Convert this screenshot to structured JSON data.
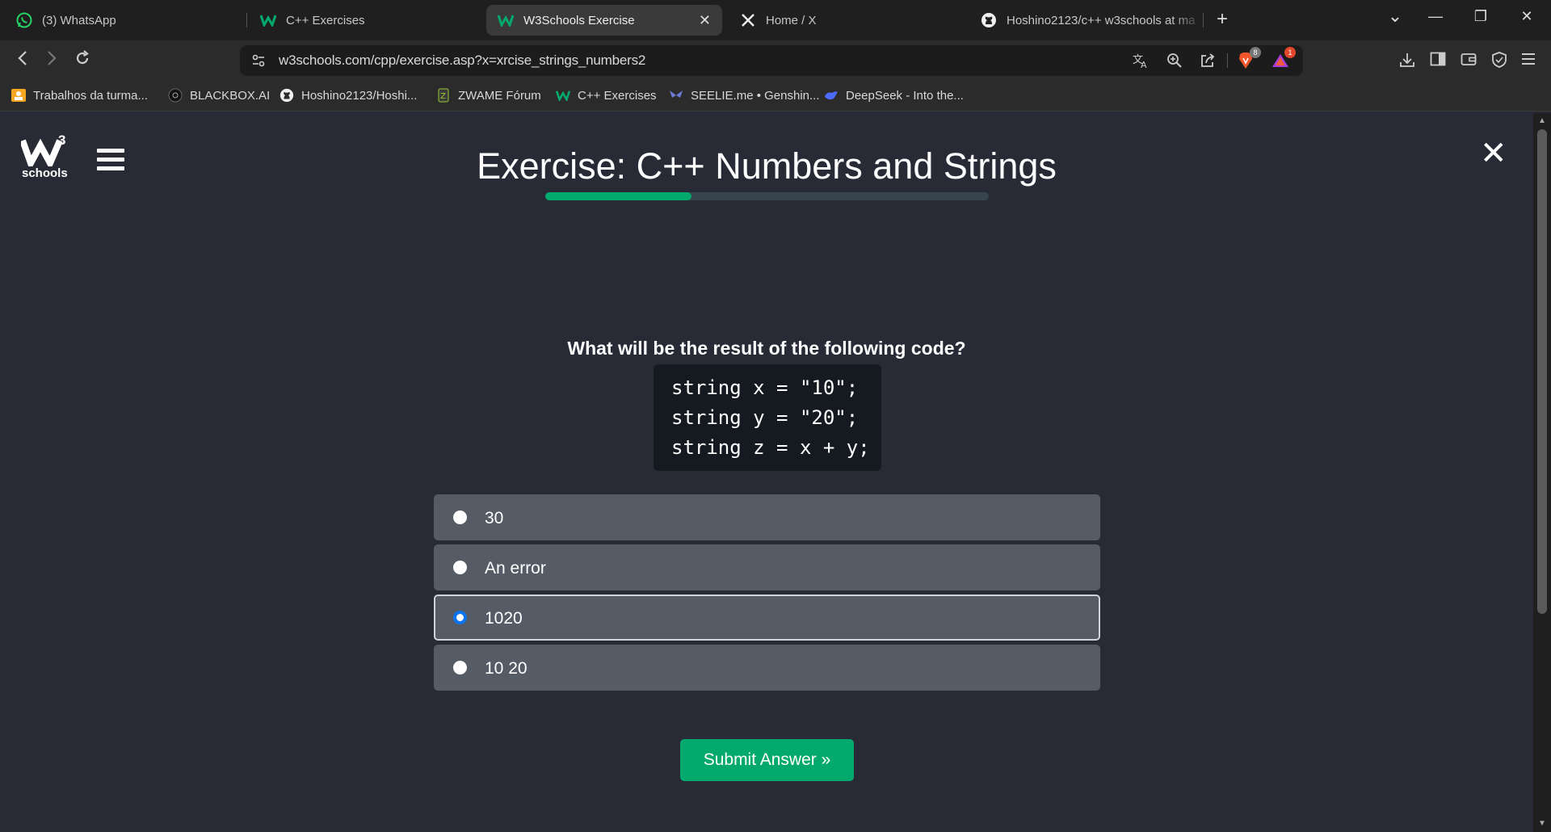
{
  "tabs": [
    {
      "title": "(3) WhatsApp",
      "icon": "whatsapp-icon"
    },
    {
      "title": "C++ Exercises",
      "icon": "w3schools-icon"
    },
    {
      "title": "W3Schools Exercise",
      "icon": "w3schools-icon",
      "active": true,
      "close": "✕"
    },
    {
      "title": "Home / X",
      "icon": "x-icon"
    },
    {
      "title": "Hoshino2123/c++ w3schools at ma",
      "icon": "github-icon"
    }
  ],
  "window_controls": {
    "dropdown": "⌄",
    "minimize": "—",
    "restore": "❐",
    "close": "✕",
    "new_tab": "+"
  },
  "address_bar": {
    "url": "w3schools.com/cpp/exercise.asp?x=xrcise_strings_numbers2",
    "brave_badge": "8",
    "rewards_badge": "1"
  },
  "bookmarks": [
    {
      "label": "Trabalhos da turma...",
      "icon": "classroom-icon"
    },
    {
      "label": "BLACKBOX.AI",
      "icon": "blackbox-icon"
    },
    {
      "label": "Hoshino2123/Hoshi...",
      "icon": "github-icon"
    },
    {
      "label": "ZWAME Fórum",
      "icon": "zwame-icon"
    },
    {
      "label": "C++ Exercises",
      "icon": "w3schools-icon"
    },
    {
      "label": "SEELIE.me • Genshin...",
      "icon": "seelie-icon"
    },
    {
      "label": "DeepSeek - Into the...",
      "icon": "deepseek-icon"
    }
  ],
  "page": {
    "logo_text": "schools",
    "logo_superscript": "3",
    "title": "Exercise: C++ Numbers and Strings",
    "progress_fraction": 0.33,
    "close_symbol": "✕",
    "question": "What will be the result of the following code?",
    "code": "string x = \"10\";\nstring y = \"20\";\nstring z = x + y;",
    "options": [
      {
        "label": "30",
        "selected": false
      },
      {
        "label": "An error",
        "selected": false
      },
      {
        "label": "1020",
        "selected": true
      },
      {
        "label": "10 20",
        "selected": false
      }
    ],
    "submit_label": "Submit Answer »"
  },
  "colors": {
    "accent": "#04aa6d",
    "page_bg": "#282a36",
    "option_bg": "#555c66",
    "radio_selected": "#0b74f0"
  }
}
